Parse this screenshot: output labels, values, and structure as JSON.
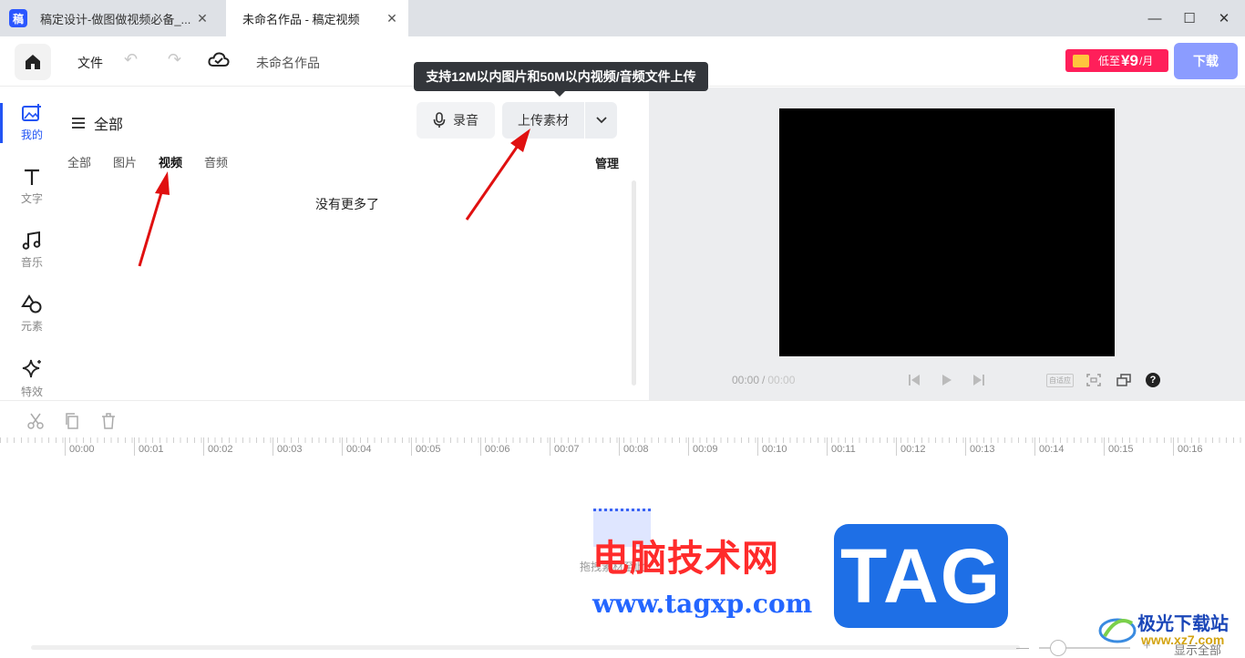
{
  "titlebar": {
    "app_icon_glyph": "稿",
    "tabs": [
      {
        "label": "稿定设计-做图做视频必备_..."
      },
      {
        "label": "未命名作品 - 稿定视频"
      }
    ]
  },
  "toolbar": {
    "file_label": "文件",
    "work_name": "未命名作品",
    "vip": {
      "prefix": "低至",
      "price": "¥9",
      "suffix": "/月"
    },
    "download_label": "下载"
  },
  "tooltip": "支持12M以内图片和50M以内视频/音频文件上传",
  "sidenav": {
    "items": [
      {
        "label": "我的",
        "icon": "my-assets-icon"
      },
      {
        "label": "文字",
        "icon": "text-icon"
      },
      {
        "label": "音乐",
        "icon": "music-icon"
      },
      {
        "label": "元素",
        "icon": "elements-icon"
      },
      {
        "label": "特效",
        "icon": "effects-icon"
      }
    ]
  },
  "panel": {
    "heading": "全部",
    "record_label": "录音",
    "upload_label": "上传素材",
    "filters": [
      "全部",
      "图片",
      "视频",
      "音频"
    ],
    "active_filter": "视频",
    "manage_label": "管理",
    "empty_text": "没有更多了"
  },
  "preview": {
    "current_time": "00:00",
    "separator": "/",
    "total_time": "00:00",
    "adapt_label": "自适应",
    "help_glyph": "?"
  },
  "timeline": {
    "ticks": [
      "00:00",
      "00:01",
      "00:02",
      "00:03",
      "00:04",
      "00:05",
      "00:06",
      "00:07",
      "00:08",
      "00:09",
      "00:10",
      "00:11",
      "00:12",
      "00:13",
      "00:14",
      "00:15",
      "00:16"
    ],
    "drop_hint": "拖拽素材至此",
    "show_all": "显示全部"
  },
  "watermark": {
    "site_cn": "电脑技术网",
    "site_url": "www.tagxp.com",
    "tag": "TAG",
    "logo_cn": "极光下载站",
    "logo_en": "www.xz7.com"
  },
  "colors": {
    "accent": "#2254f4",
    "download": "#8b9cff",
    "vip": "#ff1f5a",
    "annotation": "#e01010"
  }
}
